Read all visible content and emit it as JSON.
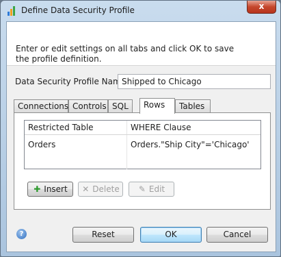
{
  "window": {
    "title": "Define Data Security Profile",
    "close_label": "x"
  },
  "banner": {
    "text": "Enter or edit settings on all tabs and click OK to save the profile definition."
  },
  "profile_name": {
    "label": "Data Security Profile Name",
    "value": "Shipped to Chicago"
  },
  "tabs": [
    {
      "label": "Connections"
    },
    {
      "label": "Controls"
    },
    {
      "label": "SQL"
    },
    {
      "label": "Rows",
      "active": true
    },
    {
      "label": "Tables"
    }
  ],
  "rows_table": {
    "columns": [
      "Restricted Table",
      "WHERE Clause"
    ],
    "rows": [
      {
        "table": "Orders",
        "where": "Orders.\"Ship City\"='Chicago'"
      }
    ]
  },
  "row_actions": {
    "insert": "Insert",
    "delete": "Delete",
    "edit": "Edit"
  },
  "footer": {
    "help_label": "?",
    "reset": "Reset",
    "ok": "OK",
    "cancel": "Cancel"
  },
  "colors": {
    "accent": "#3c7fb1",
    "insert_icon": "#2e9a2e",
    "close": "#c5472c"
  }
}
